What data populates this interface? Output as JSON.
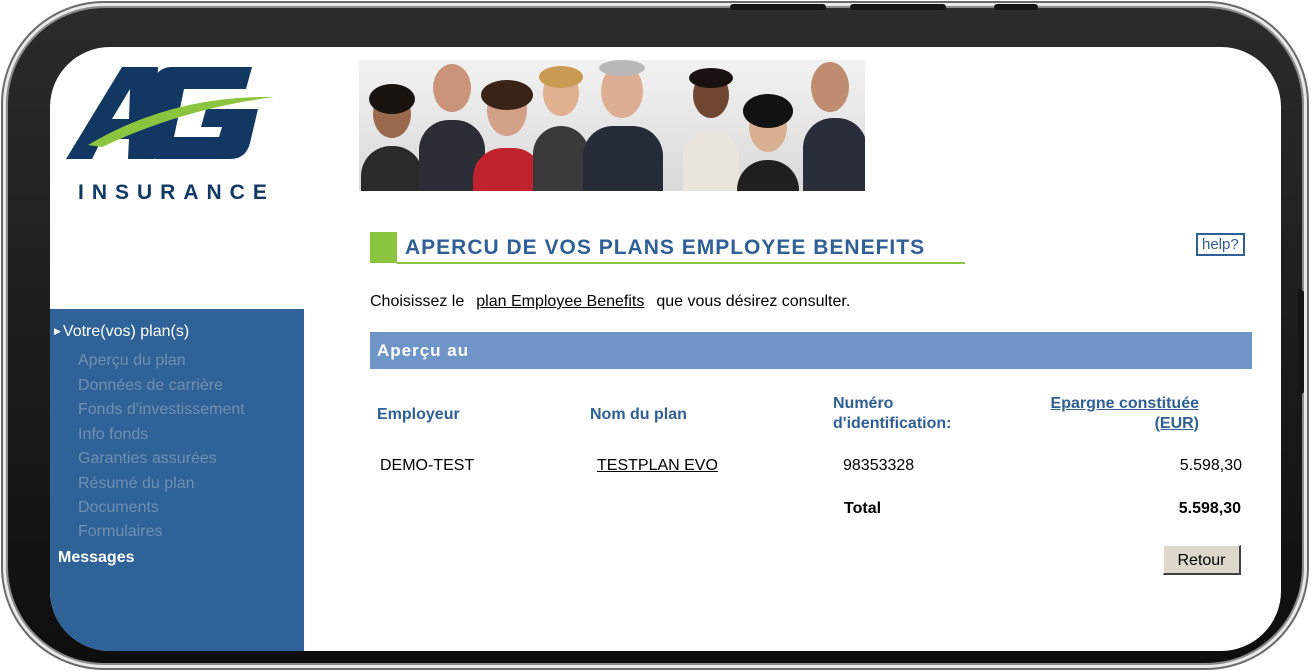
{
  "brand": {
    "logo_letters": "AG",
    "logo_text": "INSURANCE",
    "colors": {
      "navy": "#123763",
      "green": "#8bc53f",
      "sidebar": "#2f6397",
      "bar": "#6f94c7"
    }
  },
  "sidebar": {
    "section_label": "Votre(vos) plan(s)",
    "items": [
      {
        "label": "Aperçu du plan"
      },
      {
        "label": "Données de carrière"
      },
      {
        "label": "Fonds d'investissement"
      },
      {
        "label": "Info fonds"
      },
      {
        "label": "Garanties assurées"
      },
      {
        "label": "Résumé du plan"
      },
      {
        "label": "Documents"
      },
      {
        "label": "Formulaires"
      }
    ],
    "messages_label": "Messages"
  },
  "main": {
    "title": "APERCU DE VOS PLANS EMPLOYEE BENEFITS",
    "help_label": "help?",
    "intro": {
      "before": "Choisissez le",
      "link": "plan Employee Benefits",
      "after": "que vous désirez consulter."
    },
    "overview_bar": "Aperçu au",
    "table": {
      "headers": {
        "employer": "Employeur",
        "plan_name": "Nom du plan",
        "id_line1": "Numéro",
        "id_line2": "d'identification:",
        "savings_line1": "Epargne constituée",
        "savings_line2": "(EUR)"
      },
      "rows": [
        {
          "employer": "DEMO-TEST",
          "plan_name": "TESTPLAN EVO",
          "id": "98353328",
          "amount": "5.598,30"
        }
      ],
      "total_label": "Total",
      "total_amount": "5.598,30"
    },
    "back_button": "Retour"
  }
}
